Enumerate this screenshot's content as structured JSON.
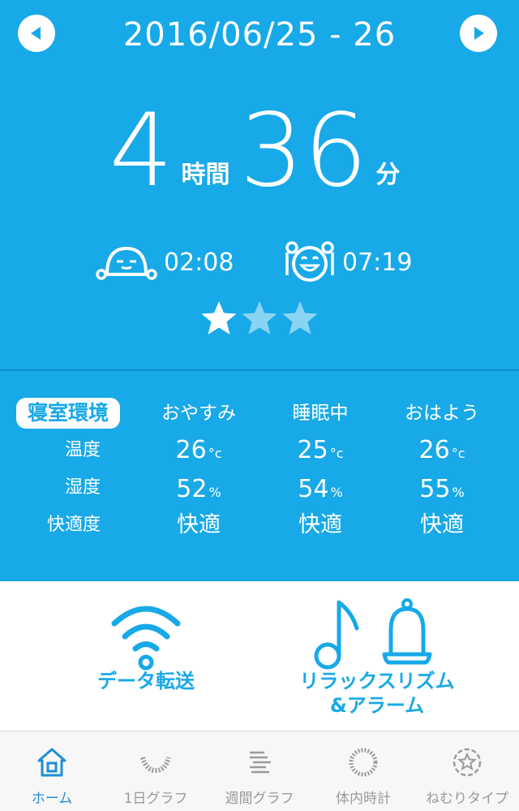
{
  "header": {
    "date_range": "2016/06/25 - 26"
  },
  "sleep": {
    "hours": "4",
    "hours_unit": "時間",
    "minutes": "36",
    "minutes_unit": "分",
    "bedtime": "02:08",
    "wake_time": "07:19",
    "rating": 1,
    "rating_max": 3
  },
  "environment": {
    "badge": "寝室環境",
    "columns": [
      "おやすみ",
      "睡眠中",
      "おはよう"
    ],
    "row_labels": {
      "temperature": "温度",
      "humidity": "湿度",
      "comfort": "快適度"
    },
    "temperature": [
      "26",
      "25",
      "26"
    ],
    "temperature_unit": "°c",
    "humidity": [
      "52",
      "54",
      "55"
    ],
    "humidity_unit": "%",
    "comfort": [
      "快適",
      "快適",
      "快適"
    ]
  },
  "actions": {
    "transfer_label": "データ転送",
    "relax_label_line1": "リラックスリズム",
    "relax_label_line2": "&アラーム"
  },
  "tabs": [
    {
      "label": "ホーム",
      "icon": "home-icon",
      "active": true
    },
    {
      "label": "1日グラフ",
      "icon": "daily-graph-icon",
      "active": false
    },
    {
      "label": "週間グラフ",
      "icon": "weekly-graph-icon",
      "active": false
    },
    {
      "label": "体内時計",
      "icon": "body-clock-icon",
      "active": false
    },
    {
      "label": "ねむりタイプ",
      "icon": "sleep-type-icon",
      "active": false
    }
  ],
  "colors": {
    "primary": "#17a9e8",
    "tab_active": "#1f8fd6",
    "tab_inactive": "#9a9a9a",
    "star_filled": "#ffffff",
    "star_empty": "#8ad4f3"
  }
}
